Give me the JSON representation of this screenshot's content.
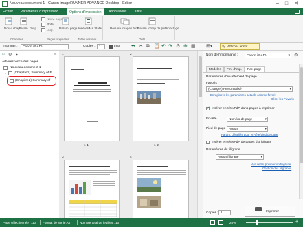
{
  "window": {
    "title": "Nouveau document 1 - Canon imageRUNNER ADVANCE Desktop - Editor",
    "minimize": "–",
    "maximize": "□",
    "close": "✕"
  },
  "menu": {
    "items": [
      "Fichier",
      "Paramètres d'impression",
      "Options d'impression",
      "Annotations",
      "Outils"
    ],
    "active_index": 2
  },
  "ribbon": {
    "nouv_chap": "Nouv. chap.",
    "param_chap": "Param. chap.",
    "group_chapitres": "Chapitres",
    "nouv_page": "Nouv. page",
    "rotat": "Rotat.",
    "dup": "Dup.",
    "param_page": "Param. page",
    "group_pages": "Pages originales",
    "inserer_mai": "Insérer/MAJ table",
    "group_table": "Table des mat.",
    "reduire": "Réduire images bloc",
    "param_imp_pub": "Param. d'imp de publipostage",
    "group_outil": "Outil"
  },
  "toolbar": {
    "imprimer_label": "Imprimer :",
    "printer": "Canon iR-ADV",
    "copies_label": "Copies :",
    "copies": "1",
    "imp_label": "Imp.",
    "afficher_annot": "Afficher annot."
  },
  "left_panel": {
    "title": "Arborescence des pages",
    "root": "Nouveau document 1",
    "chapter1": "(Chapitre1) Summary of F",
    "chapter2": "(Chapitre2) Summary of"
  },
  "pages": [
    {
      "num": "1",
      "caption": "1-1"
    },
    {
      "num": "2",
      "caption": "1-2"
    },
    {
      "num": "3",
      "caption": ""
    },
    {
      "num": "4",
      "caption": ""
    }
  ],
  "right_panel": {
    "printer_label": "Nom de l'imprimante :",
    "printer_value": "Canon iR-ADV",
    "tabs": [
      "Modèles",
      "Fin. d'imp.",
      "Par. page"
    ],
    "active_tab": 2,
    "section_title": "Paramètres d'en-tête/pied de page",
    "favoris_label": "Favoris",
    "favoris_value": "(Changer) Personnalisé",
    "link_enregistrer": "Enregistrer les paramètres actuels comme favori",
    "link_gerer": "Gérer les Favoris",
    "cb_inserer_entete": "Insérer en-tête/PdP dans pages à imprimer",
    "entete_label": "En-tête",
    "entete_value": "Numéro de page",
    "pied_label": "Pied de page",
    "pied_value": "Aucun",
    "link_parametres": "Param. détaillés pour en-tête/pied de page",
    "cb_inserer_origine": "Insérer en-tête/PdP de pages d'originaux",
    "filigrane_title": "Paramètres du filigrane",
    "filigrane_value": "Aucun filigrane",
    "link_ajouter": "Ajouter/supprimer un filigrane",
    "link_gestion": "Gestion des filigranes",
    "copies_label": "Copies :",
    "copies_value": "1",
    "imprimer_btn": "Imprimer"
  },
  "status": {
    "page_sel": "Page sélectionnée : /10",
    "format": "Format de sortie A4",
    "total": "Nombre total de feuilles : 10",
    "zoom": "25%"
  },
  "colors": {
    "brand_green": "#1e7145",
    "highlight_red": "#e02020"
  }
}
